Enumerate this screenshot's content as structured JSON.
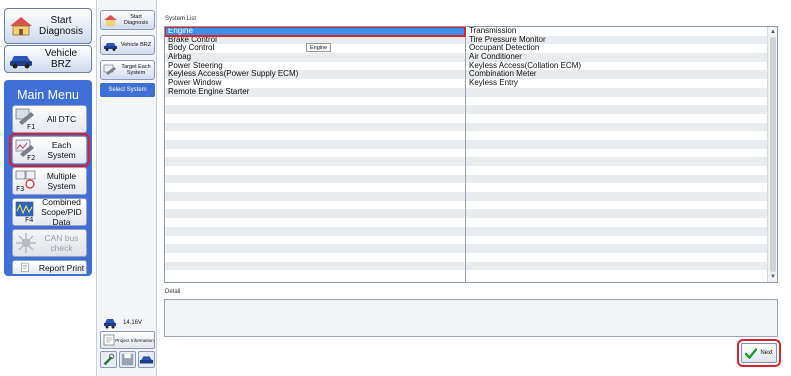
{
  "sidebar": {
    "start_diagnosis": "Start Diagnosis",
    "vehicle": "Vehicle BRZ",
    "main_menu_title": "Main Menu",
    "menu": [
      {
        "label": "All DTC",
        "state": "normal"
      },
      {
        "label": "Each System",
        "state": "selected"
      },
      {
        "label": "Multiple System",
        "state": "normal"
      },
      {
        "label": "Combined Scope/PID Data",
        "state": "normal"
      },
      {
        "label": "CAN bus check",
        "state": "disabled"
      },
      {
        "label": "Report Print",
        "state": "normal"
      }
    ]
  },
  "mid": {
    "start_diagnosis": "Start Diagnosis",
    "vehicle": "Vehicle BRZ",
    "target": "Target Each System",
    "select_system": "Select System",
    "voltage": "14.16V",
    "project_info": "Project Information"
  },
  "main": {
    "system_list_label": "System List",
    "left_column": [
      "Engine",
      "Brake Control",
      "Body Control",
      "Airbag",
      "Power Steering",
      "Keyless Access(Power Supply ECM)",
      "Power Window",
      "Remote Engine Starter"
    ],
    "right_column": [
      "Transmission",
      "Tire Pressure Monitor",
      "Occupant Detection",
      "Air Conditioner",
      "Keyless Access(Collation ECM)",
      "Combination Meter",
      "Keyless Entry"
    ],
    "selected": "Engine",
    "tooltip": "Engine",
    "detail_label": "Detail",
    "next_label": "Next"
  },
  "colors": {
    "menu_blue": "#3f6fd6",
    "selection_blue": "#3d8fe9",
    "highlight_red": "#d9222b"
  }
}
